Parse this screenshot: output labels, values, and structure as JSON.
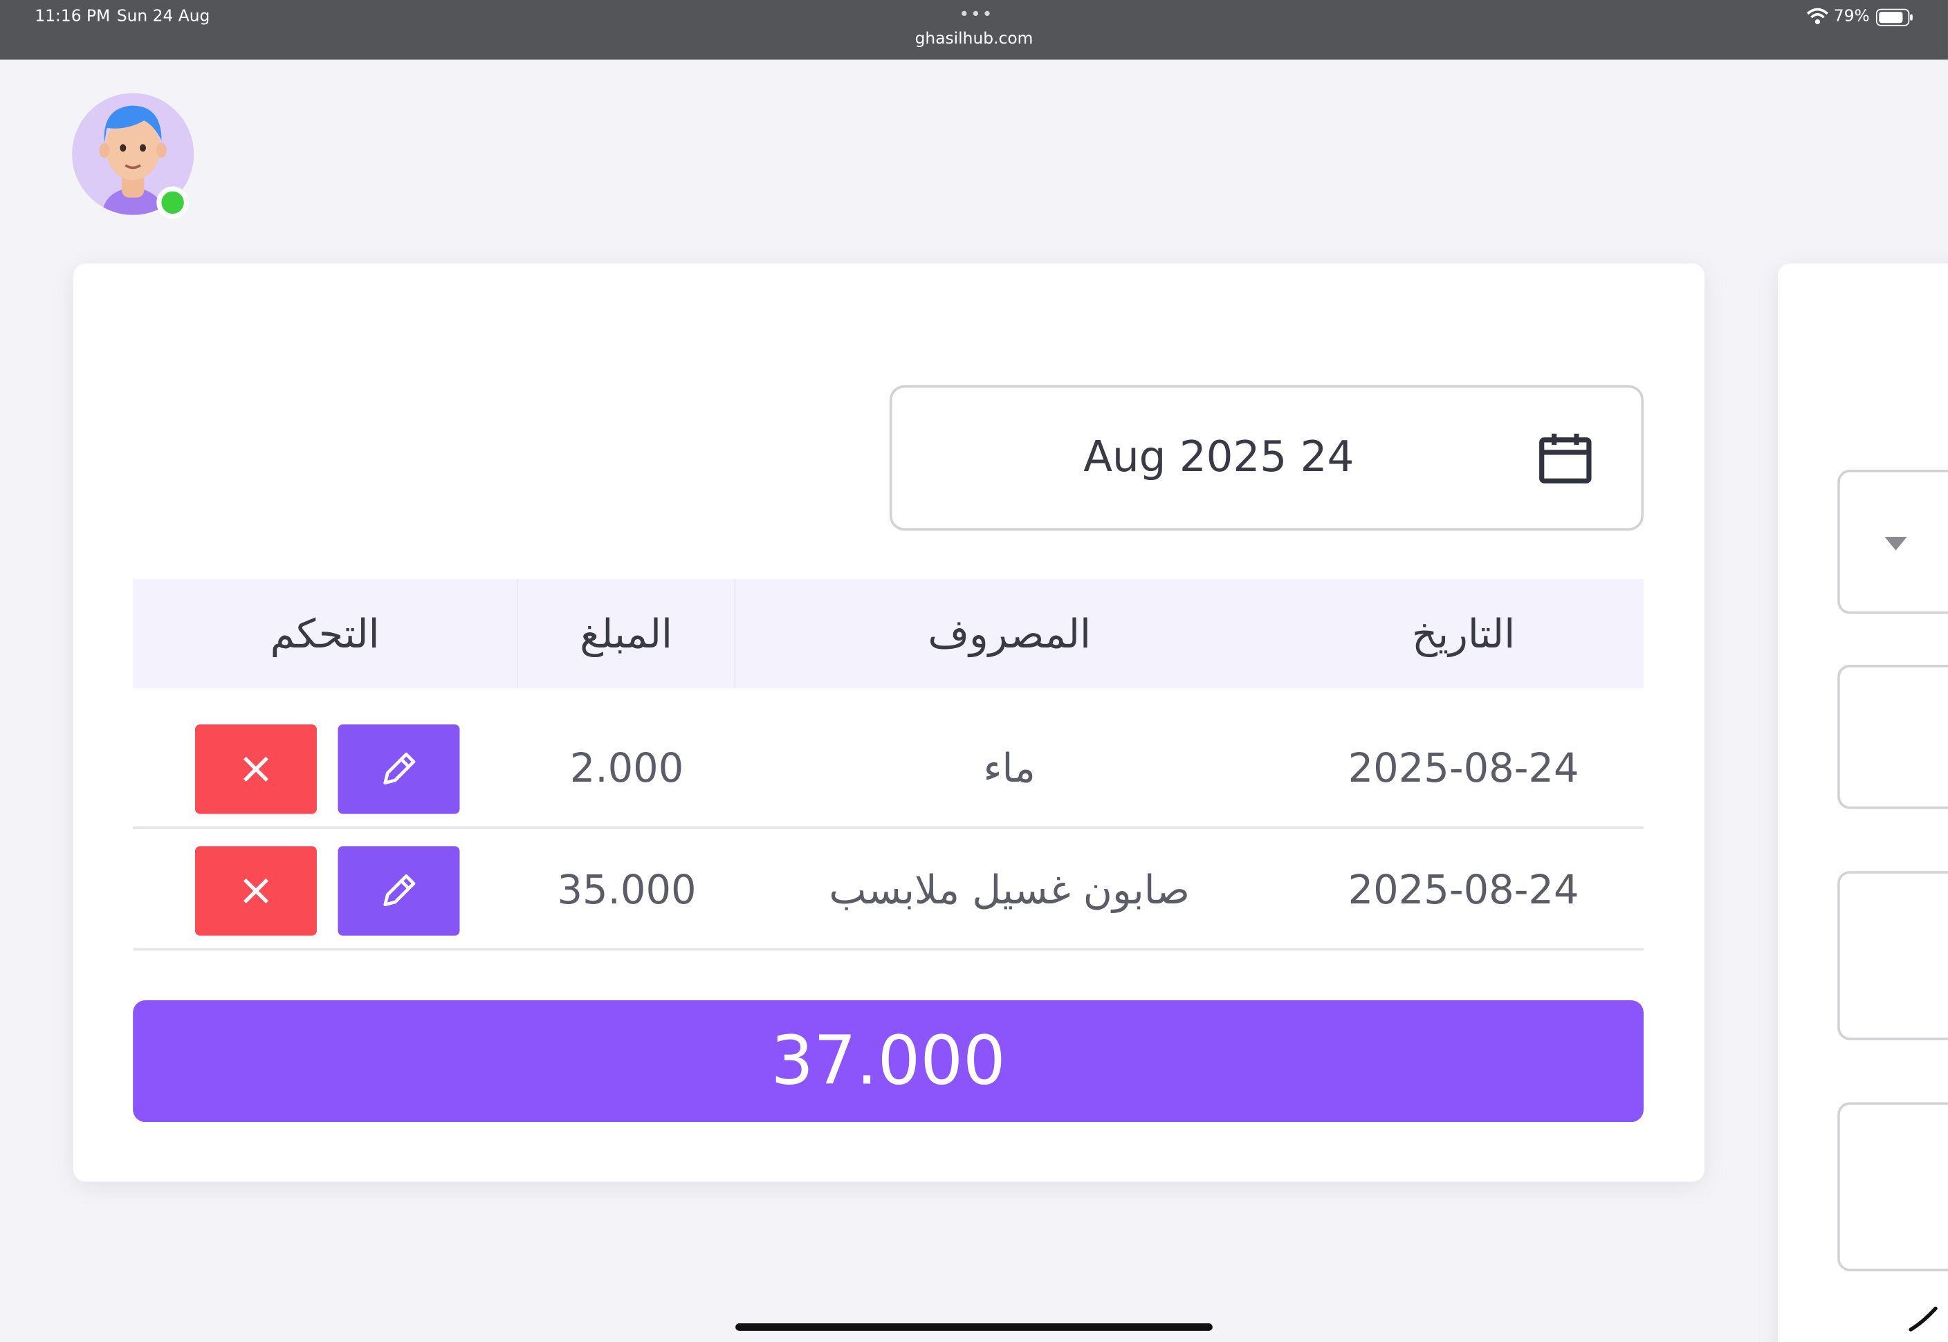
{
  "status_bar": {
    "time": "11:16 PM",
    "date": "Sun 24 Aug",
    "dots": "•••",
    "url": "ghasilhub.com",
    "battery": "79%",
    "icons": [
      "wifi-icon",
      "battery-icon"
    ]
  },
  "user": {
    "avatar_icon": "user-avatar",
    "status": "online",
    "status_color": "#3ecf3e"
  },
  "date_picker": {
    "value": "Aug 2025 24",
    "icon": "calendar-icon"
  },
  "table": {
    "headers": {
      "control": "التحكم",
      "amount": "المبلغ",
      "expense": "المصروف",
      "date": "التاريخ"
    },
    "rows": [
      {
        "date": "2025-08-24",
        "expense": "ماء",
        "amount": "2.000"
      },
      {
        "date": "2025-08-24",
        "expense": "صابون غسيل ملابسب",
        "amount": "35.000"
      }
    ],
    "actions": {
      "edit_icon": "pencil-icon",
      "delete_icon": "close-icon"
    }
  },
  "total": "37.000",
  "colors": {
    "accent": "#8c55fc",
    "edit": "#8555f5",
    "delete": "#fa4b54",
    "header_bg": "#f4f2fd"
  }
}
